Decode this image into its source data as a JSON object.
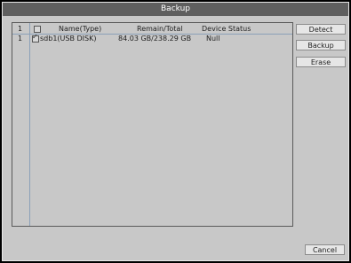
{
  "window": {
    "title": "Backup"
  },
  "table": {
    "header": {
      "index": "1",
      "name": "Name(Type)",
      "remain": "Remain/Total",
      "status": "Device Status"
    },
    "rows": [
      {
        "index": "1",
        "name": "sdb1(USB DISK)",
        "remain": "84.03 GB/238.29 GB",
        "status": "Null",
        "checked": true
      }
    ]
  },
  "buttons": {
    "detect": "Detect",
    "backup": "Backup",
    "erase": "Erase",
    "cancel": "Cancel"
  }
}
